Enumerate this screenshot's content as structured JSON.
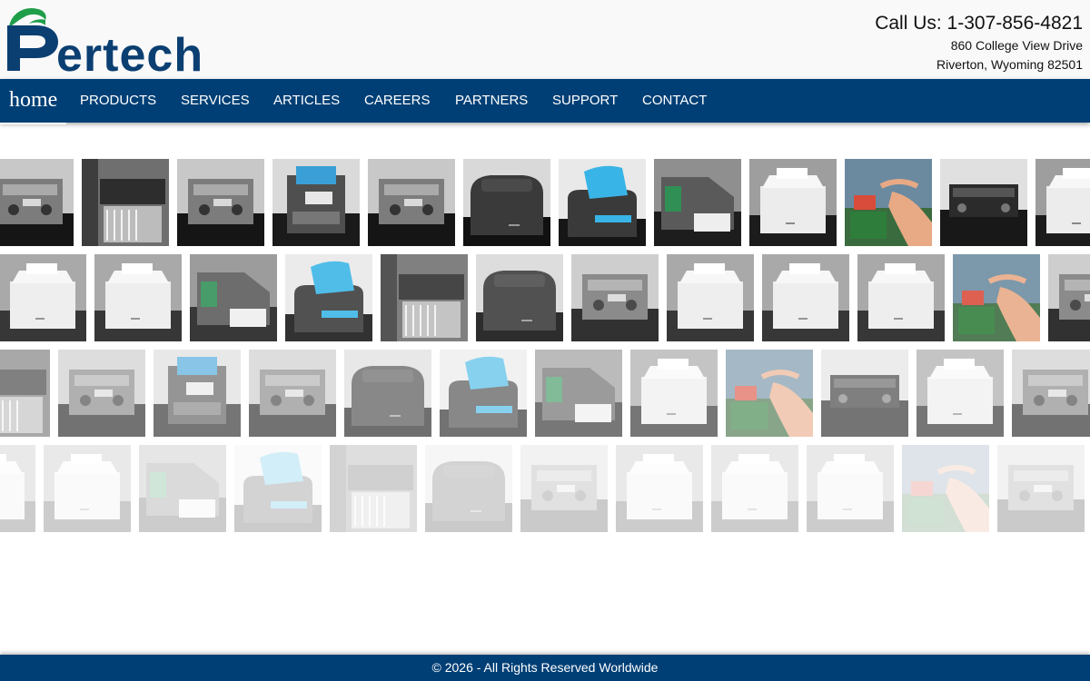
{
  "header": {
    "logo_text": "Pertech",
    "phone": "Call Us: 1-307-856-4821",
    "address_line1": "860 College View Drive",
    "address_line2": "Riverton, Wyoming 82501"
  },
  "nav": {
    "items": [
      {
        "id": "home",
        "label": "home",
        "active": true
      },
      {
        "id": "products",
        "label": "PRODUCTS"
      },
      {
        "id": "services",
        "label": "SERVICES"
      },
      {
        "id": "articles",
        "label": "ARTICLES"
      },
      {
        "id": "careers",
        "label": "CAREERS"
      },
      {
        "id": "partners",
        "label": "PARTNERS"
      },
      {
        "id": "support",
        "label": "SUPPORT"
      },
      {
        "id": "contact",
        "label": "CONTACT"
      }
    ]
  },
  "gallery": {
    "rows": [
      {
        "opacity": 1.0,
        "items": [
          "mechanism",
          "printer-rack",
          "mechanism",
          "kiosk-printer-blue",
          "mechanism",
          "dark-receipt-printer",
          "printer-blue-paper",
          "slip-printer",
          "white-receipt-printer",
          "circuit-assembly",
          "mechanism-black",
          "white-receipt-printer"
        ]
      },
      {
        "opacity": 0.88,
        "items": [
          "white-receipt-printer",
          "white-receipt-printer",
          "slip-printer",
          "printer-blue-paper",
          "printer-rack",
          "dark-receipt-printer",
          "mechanism",
          "white-receipt-printer",
          "white-receipt-printer",
          "white-receipt-printer",
          "circuit-assembly",
          "mechanism"
        ]
      },
      {
        "opacity": 0.6,
        "items": [
          "printer-rack",
          "mechanism",
          "kiosk-printer-blue",
          "mechanism",
          "dark-receipt-printer",
          "printer-blue-paper",
          "slip-printer",
          "white-receipt-printer",
          "circuit-assembly",
          "mechanism-black",
          "white-receipt-printer",
          "mechanism"
        ]
      },
      {
        "opacity": 0.22,
        "items": [
          "white-receipt-printer",
          "white-receipt-printer",
          "slip-printer",
          "printer-blue-paper",
          "printer-rack",
          "dark-receipt-printer",
          "mechanism",
          "white-receipt-printer",
          "white-receipt-printer",
          "white-receipt-printer",
          "circuit-assembly",
          "mechanism",
          "white-receipt-printer"
        ]
      }
    ]
  },
  "footer": {
    "text": "© 2026 - All Rights Reserved Worldwide"
  },
  "colors": {
    "brand_blue": "#003f75",
    "logo_blue": "#0b3f72",
    "logo_green": "#1f9e4a"
  }
}
